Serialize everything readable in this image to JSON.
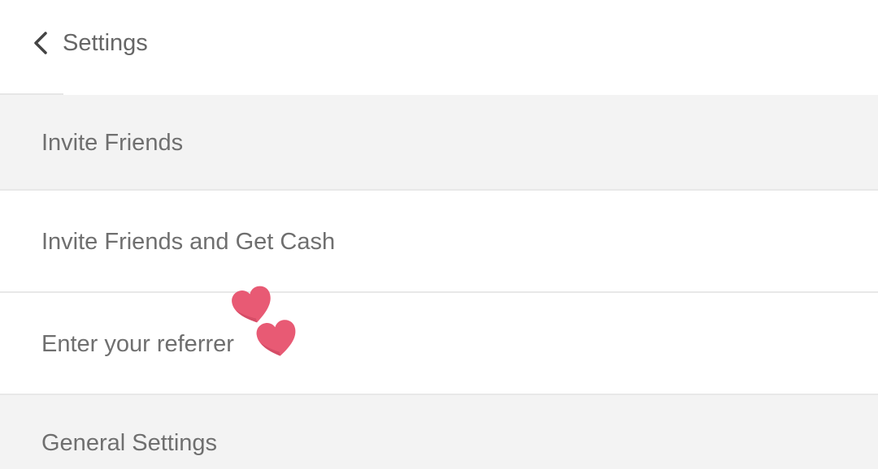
{
  "header": {
    "title": "Settings",
    "back_icon": "chevron-left-icon"
  },
  "sections": {
    "invite": {
      "label": "Invite Friends",
      "items": [
        {
          "label": "Invite Friends and Get Cash"
        },
        {
          "label": "Enter your referrer"
        }
      ]
    },
    "general": {
      "label": "General Settings"
    }
  },
  "decoration": {
    "icon": "heart-icon",
    "color": "#e85a74"
  }
}
